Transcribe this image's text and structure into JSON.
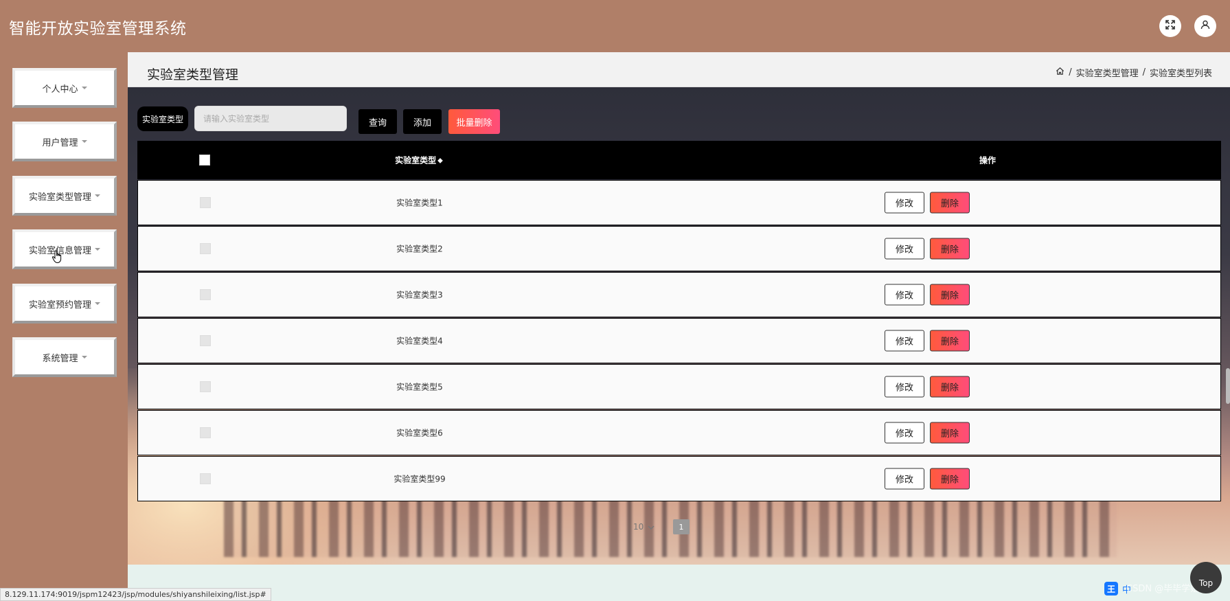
{
  "app": {
    "title": "智能开放实验室管理系统"
  },
  "sidebar": {
    "items": [
      {
        "label": "个人中心"
      },
      {
        "label": "用户管理"
      },
      {
        "label": "实验室类型管理"
      },
      {
        "label": "实验室信息管理"
      },
      {
        "label": "实验室预约管理"
      },
      {
        "label": "系统管理"
      }
    ]
  },
  "page": {
    "title": "实验室类型管理",
    "breadcrumb": [
      "实验室类型管理",
      "实验室类型列表"
    ],
    "breadcrumb_sep": "/"
  },
  "search": {
    "label": "实验室类型",
    "placeholder": "请输入实验室类型",
    "query_label": "查询",
    "add_label": "添加",
    "batch_delete_label": "批量删除"
  },
  "table": {
    "columns": {
      "type": "实验室类型",
      "actions": "操作"
    },
    "rows": [
      {
        "type": "实验室类型1"
      },
      {
        "type": "实验室类型2"
      },
      {
        "type": "实验室类型3"
      },
      {
        "type": "实验室类型4"
      },
      {
        "type": "实验室类型5"
      },
      {
        "type": "实验室类型6"
      },
      {
        "type": "实验室类型99"
      }
    ],
    "edit_label": "修改",
    "delete_label": "删除"
  },
  "pagination": {
    "page_size": "10",
    "current_page": "1"
  },
  "footer": {
    "status_url": "8.129.11.174:9019/jspm12423/jsp/modules/shiyanshileixing/list.jsp#",
    "top_label": "Top",
    "watermark": "CSDN @毕毕学姐",
    "ime_logo": "王",
    "ime_mode": "中"
  },
  "colors": {
    "header": "#b07f68",
    "danger_start": "#ff5a3c",
    "danger_end": "#ff4d7a"
  }
}
